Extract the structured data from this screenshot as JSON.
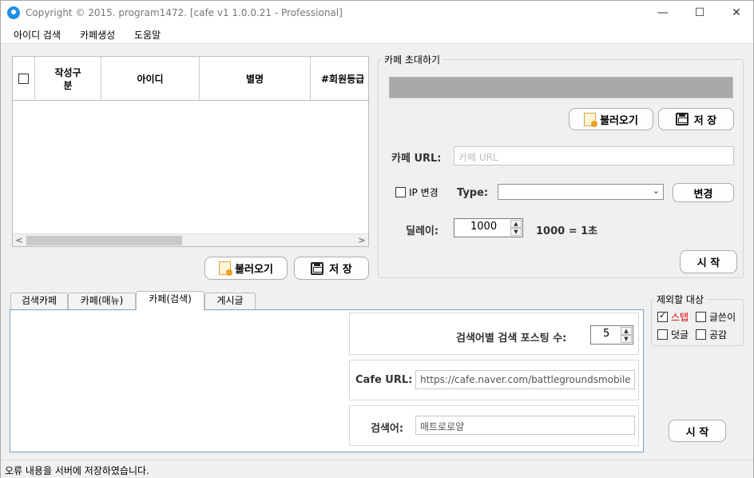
{
  "window": {
    "title": "Copyright © 2015. program1472. [cafe v1 1.0.0.21 - Professional]",
    "minimize": "—",
    "maximize": "☐",
    "close": "✕"
  },
  "menu": [
    "아이디 검색",
    "카페생성",
    "도움말"
  ],
  "grid": {
    "columns": [
      "작성구\n분",
      "아이디",
      "별명",
      "#회원등급"
    ],
    "rows": []
  },
  "left_buttons": {
    "load": "불러오기",
    "save": "저 장"
  },
  "invite": {
    "group_title": "카페 초대하기",
    "load_label": "불러오기",
    "save_label": "저 장",
    "cafe_url_label": "카페 URL:",
    "cafe_url_placeholder": "카페 URL",
    "ip_change_label": "IP 변경",
    "type_label": "Type:",
    "type_value": "",
    "change_label": "변경",
    "delay_label": "딜레이:",
    "delay_value": "1000",
    "delay_hint": "1000 = 1초",
    "start_label": "시  작"
  },
  "tabs": [
    "검색카페",
    "카페(매뉴)",
    "카페(검색)",
    "게시글"
  ],
  "active_tab": "카페(검색)",
  "search_panel": {
    "posting_count_label": "검색어별 검색 포스팅 수:",
    "posting_count_value": "5",
    "cafe_url_label": "Cafe URL:",
    "cafe_url_value": "https://cafe.naver.com/battlegroundsmobile",
    "keyword_label": "검색어:",
    "keyword_value": "매트로로얄"
  },
  "exclude": {
    "group_title": "제외할 대상",
    "items": [
      {
        "label": "스텝",
        "checked": true,
        "color": "#e00000"
      },
      {
        "label": "글쓴이",
        "checked": false
      },
      {
        "label": "덧글",
        "checked": false
      },
      {
        "label": "공감",
        "checked": false
      }
    ]
  },
  "bottom_start": "시  작",
  "status": "오류 내용을 서버에 저장하였습니다."
}
